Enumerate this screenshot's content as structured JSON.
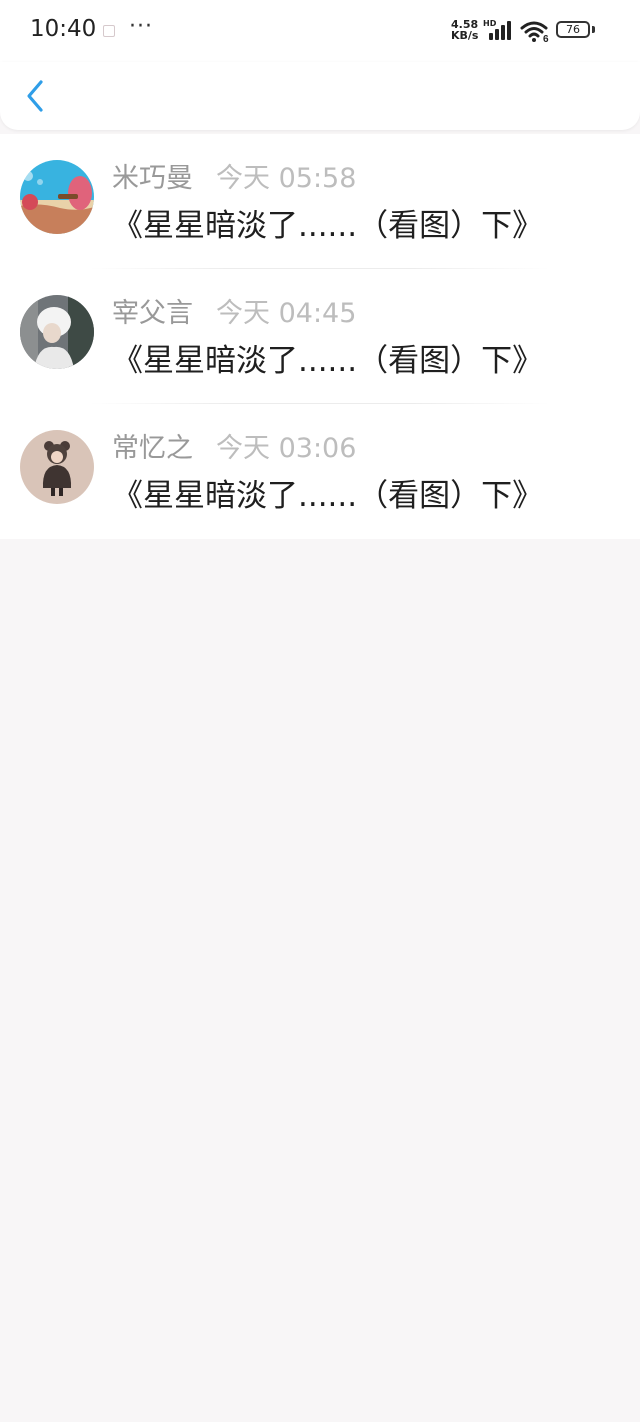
{
  "status_bar": {
    "time": "10:40",
    "more": "···",
    "net_speed_value": "4.58",
    "net_speed_unit": "KB/s",
    "hd": "HD",
    "wifi_badge": "6",
    "battery": "76"
  },
  "header": {
    "back_icon": "chevron-left-icon",
    "accent_color": "#2f9ee8"
  },
  "comments": [
    {
      "name": "米巧曼",
      "time": "今天 05:58",
      "text": "《星星暗淡了......（看图）下》"
    },
    {
      "name": "宰父言",
      "time": "今天 04:45",
      "text": "《星星暗淡了......（看图）下》"
    },
    {
      "name": "常忆之",
      "time": "今天 03:06",
      "text": "《星星暗淡了......（看图）下》"
    }
  ]
}
